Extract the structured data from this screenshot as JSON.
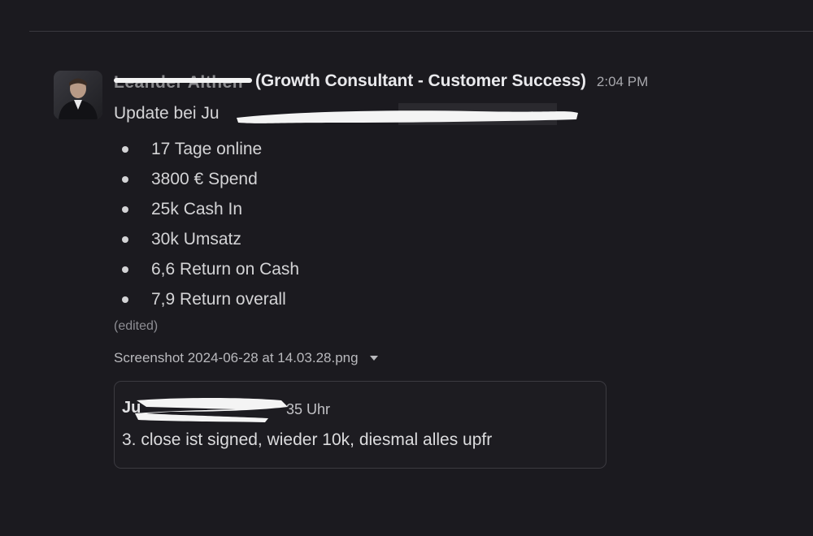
{
  "message": {
    "sender": {
      "name_visible_fragment": "Leander Althen",
      "role": "(Growth Consultant - Customer Success)"
    },
    "timestamp": "2:04 PM",
    "intro_text": "Update bei Ju",
    "bullets": [
      "17 Tage online",
      "3800 € Spend",
      "25k Cash In",
      "30k Umsatz",
      "6,6 Return on Cash",
      "7,9 Return overall"
    ],
    "edited_label": "(edited)",
    "attachment": {
      "filename": "Screenshot 2024-06-28 at 14.03.28.png",
      "icon": "caret-down-icon"
    },
    "quoted_message": {
      "author_fragment": "Ju",
      "time_fragment": "35 Uhr",
      "text": "3. close ist signed, wieder 10k, diesmal alles upfr"
    }
  },
  "colors": {
    "background": "#1b1a1f",
    "text_primary": "#d6d6d8",
    "text_muted": "#8d8d93",
    "redaction": "#f4f4f4"
  }
}
